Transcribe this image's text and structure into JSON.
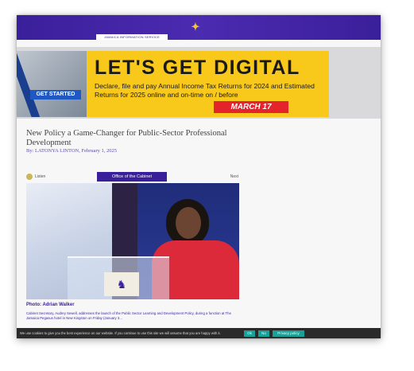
{
  "header": {
    "site_label": "JAMAICA INFORMATION SERVICE",
    "logo_glyph": "✦",
    "bar_color": "#3a1f9a"
  },
  "banner": {
    "headline": "LET'S GET DIGITAL",
    "body": "Declare, file and pay Annual Income Tax Returns for 2024 and Estimated Returns for 2025 online and on-time on / before",
    "date_label": "MARCH 17",
    "cta_label": "GET STARTED",
    "background_color": "#f8c81a"
  },
  "article": {
    "title": "New Policy a Game-Changer for Public-Sector Professional Development",
    "byline": "By: LATONYA LINTON, February 1, 2025"
  },
  "gallery": {
    "listen_label": "Listen",
    "active_tab_label": "Office of the Cabinet",
    "next_label": "Next"
  },
  "photo": {
    "credit": "Photo: Adrian Walker",
    "caption": "Cabinet Secretary, Audrey Sewell, addresses the launch of the Public Sector Learning and Development Policy, during a function at The Jamaica Pegasus hotel in New Kingston on Friday (January 3..."
  },
  "cookie_bar": {
    "text": "We use cookies to give you the best experience on our website. If you continue to use this site we will assume that you are happy with it.",
    "ok_label": "Ok",
    "no_label": "No",
    "privacy_label": "Privacy policy"
  }
}
